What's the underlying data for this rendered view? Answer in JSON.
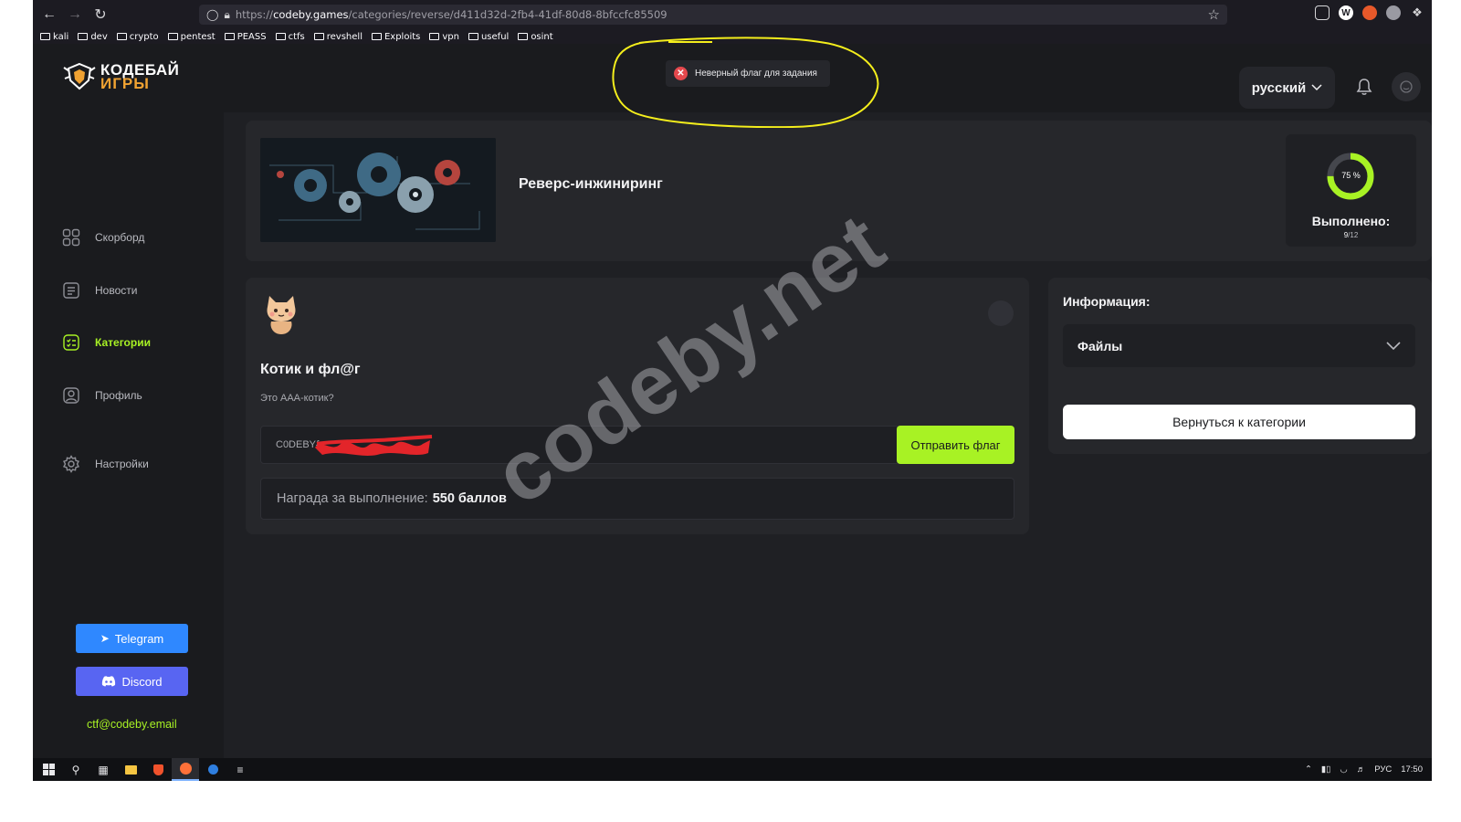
{
  "browser": {
    "url_scheme": "https://",
    "url_host": "codeby.games",
    "url_path": "/categories/reverse/d411d32d-2fb4-41df-80d8-8bfccfc85509",
    "bookmarks": [
      "kali",
      "dev",
      "crypto",
      "pentest",
      "PEASS",
      "ctfs",
      "revshell",
      "Exploits",
      "vpn",
      "useful",
      "osint"
    ]
  },
  "brand": {
    "line1": "КОДЕБАЙ",
    "line2": "ИГРЫ",
    "accent": "#a8f224",
    "orange": "#f0a232"
  },
  "toast": {
    "text": "Неверный флаг для задания",
    "color": "#e5484d"
  },
  "topbar": {
    "language": "русский"
  },
  "sidebar": {
    "items": [
      {
        "label": "Скорборд",
        "icon": "grid-icon"
      },
      {
        "label": "Новости",
        "icon": "news-icon"
      },
      {
        "label": "Категории",
        "icon": "categories-icon",
        "active": true
      },
      {
        "label": "Профиль",
        "icon": "profile-icon"
      },
      {
        "label": "Настройки",
        "icon": "settings-icon"
      }
    ],
    "telegram_label": "Telegram",
    "discord_label": "Discord",
    "email": "ctf@codeby.email"
  },
  "category": {
    "title": "Реверс-инжиниринг",
    "progress_percent_label": "75 %",
    "progress_fraction": 0.75,
    "done_label": "Выполнено:",
    "done_count": "9",
    "total_count": "/12"
  },
  "task": {
    "title": "Котик и фл@г",
    "description": "Это ААА-котик?",
    "flag_value": "C0DEBY{",
    "submit_label": "Отправить флаг",
    "reward_label": "Награда за выполнение:",
    "reward_value": "550 баллов"
  },
  "info": {
    "title": "Информация:",
    "files_label": "Файлы",
    "back_label": "Вернуться к категории"
  },
  "watermark": "codeby.net",
  "taskbar": {
    "lang": "РУС",
    "time": "17:50"
  }
}
